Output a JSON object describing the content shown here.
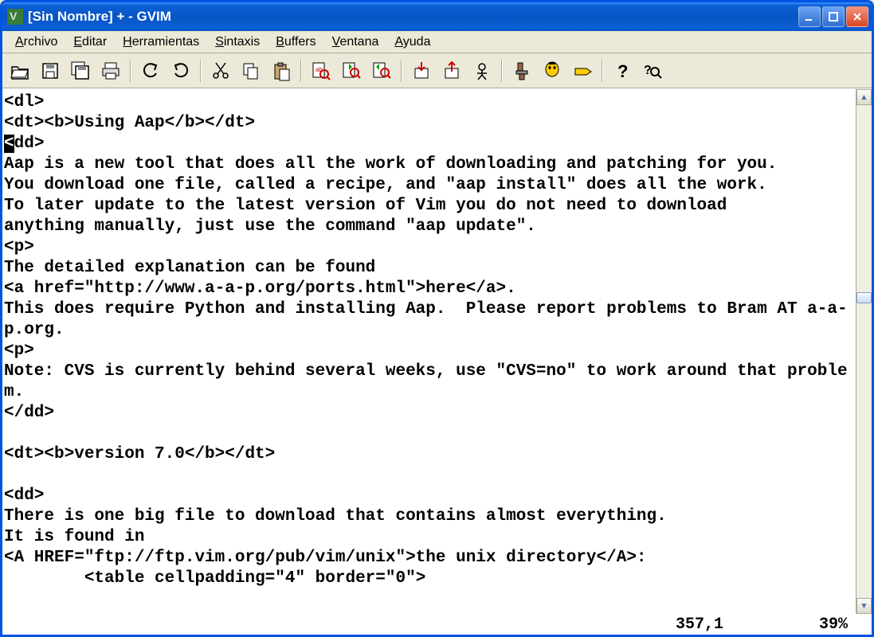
{
  "window": {
    "title": "[Sin Nombre] + - GVIM"
  },
  "menu": {
    "items": [
      "Archivo",
      "Editar",
      "Herramientas",
      "Sintaxis",
      "Buffers",
      "Ventana",
      "Ayuda"
    ]
  },
  "toolbar": {
    "items": [
      {
        "name": "open-icon"
      },
      {
        "name": "save-icon"
      },
      {
        "name": "save-all-icon"
      },
      {
        "name": "print-icon"
      },
      {
        "sep": true
      },
      {
        "name": "undo-icon"
      },
      {
        "name": "redo-icon"
      },
      {
        "sep": true
      },
      {
        "name": "cut-icon"
      },
      {
        "name": "copy-icon"
      },
      {
        "name": "paste-icon"
      },
      {
        "sep": true
      },
      {
        "name": "find-replace-icon"
      },
      {
        "name": "find-next-icon"
      },
      {
        "name": "find-prev-icon"
      },
      {
        "sep": true
      },
      {
        "name": "load-session-icon"
      },
      {
        "name": "save-session-icon"
      },
      {
        "name": "run-script-icon"
      },
      {
        "sep": true
      },
      {
        "name": "make-icon"
      },
      {
        "name": "shell-icon"
      },
      {
        "name": "tags-icon"
      },
      {
        "sep": true
      },
      {
        "name": "help-icon"
      },
      {
        "name": "find-help-icon"
      }
    ]
  },
  "editor": {
    "lines": [
      "<dl>",
      "<dt><b>Using Aap</b></dt>",
      {
        "cursor": "<",
        "rest": "dd>"
      },
      "Aap is a new tool that does all the work of downloading and patching for you.",
      "You download one file, called a recipe, and \"aap install\" does all the work.",
      "To later update to the latest version of Vim you do not need to download",
      "anything manually, just use the command \"aap update\".",
      "<p>",
      "The detailed explanation can be found",
      "<a href=\"http://www.a-a-p.org/ports.html\">here</a>.",
      "This does require Python and installing Aap.  Please report problems to Bram AT a-a-p.org.",
      "<p>",
      "Note: CVS is currently behind several weeks, use \"CVS=no\" to work around that problem.",
      "</dd>",
      "",
      "<dt><b>version 7.0</b></dt>",
      "",
      "<dd>",
      "There is one big file to download that contains almost everything.",
      "It is found in",
      "<A HREF=\"ftp://ftp.vim.org/pub/vim/unix\">the unix directory</A>:",
      "        <table cellpadding=\"4\" border=\"0\">"
    ]
  },
  "status": {
    "position": "357,1",
    "percent": "39%"
  }
}
